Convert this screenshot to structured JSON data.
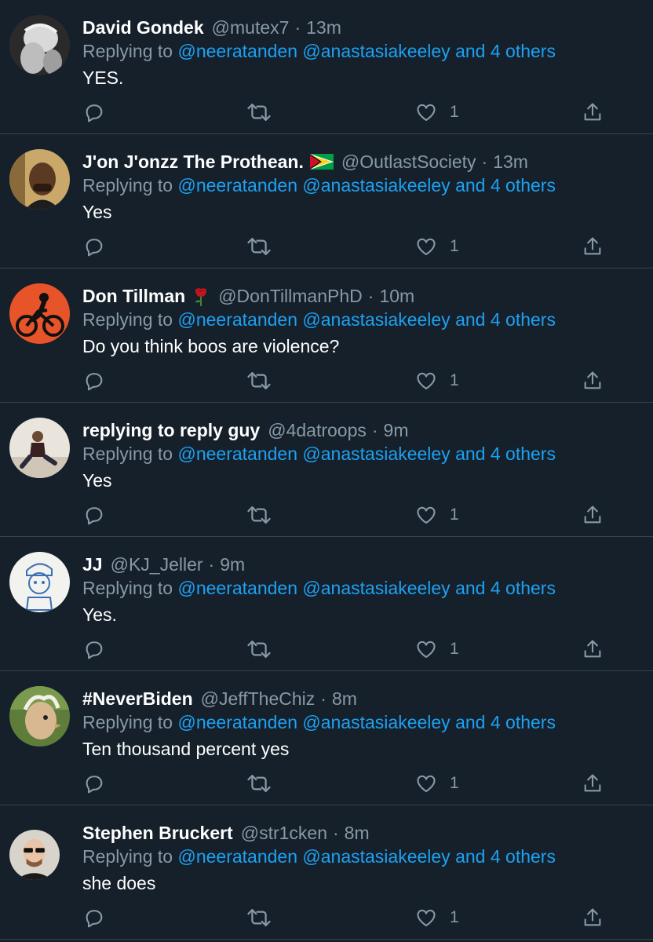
{
  "replying_prefix": "Replying to",
  "mention_1": "@neeratanden",
  "mention_2": "@anastasiakeeley",
  "mention_others": "and 4 others",
  "colors": {
    "background": "#15202b",
    "divider": "#38444d",
    "secondary_text": "#8899a6",
    "link": "#1da1f2"
  },
  "icons": {
    "reply": "reply-icon",
    "retweet": "retweet-icon",
    "like": "heart-icon",
    "share": "share-icon"
  },
  "tweets": [
    {
      "name": "David Gondek",
      "handle": "@mutex7",
      "dot": "·",
      "time": "13m",
      "text": "YES.",
      "likes": "1",
      "emoji": ""
    },
    {
      "name": "J'on J'onzz The Prothean.",
      "handle": "@OutlastSociety",
      "dot": "·",
      "time": "13m",
      "text": "Yes",
      "likes": "1",
      "emoji": "guyana-flag"
    },
    {
      "name": "Don Tillman",
      "handle": "@DonTillmanPhD",
      "dot": "·",
      "time": "10m",
      "text": "Do you think boos are violence?",
      "likes": "1",
      "emoji": "rose"
    },
    {
      "name": "replying to reply guy",
      "handle": "@4datroops",
      "dot": "·",
      "time": "9m",
      "text": "Yes",
      "likes": "1",
      "emoji": ""
    },
    {
      "name": "JJ",
      "handle": "@KJ_Jeller",
      "dot": "·",
      "time": "9m",
      "text": "Yes.",
      "likes": "1",
      "emoji": ""
    },
    {
      "name": "#NeverBiden",
      "handle": "@JeffTheChiz",
      "dot": "·",
      "time": "8m",
      "text": "Ten thousand percent yes",
      "likes": "1",
      "emoji": ""
    },
    {
      "name": "Stephen Bruckert",
      "handle": "@str1cken",
      "dot": "·",
      "time": "8m",
      "text": "she does",
      "likes": "1",
      "emoji": ""
    }
  ]
}
